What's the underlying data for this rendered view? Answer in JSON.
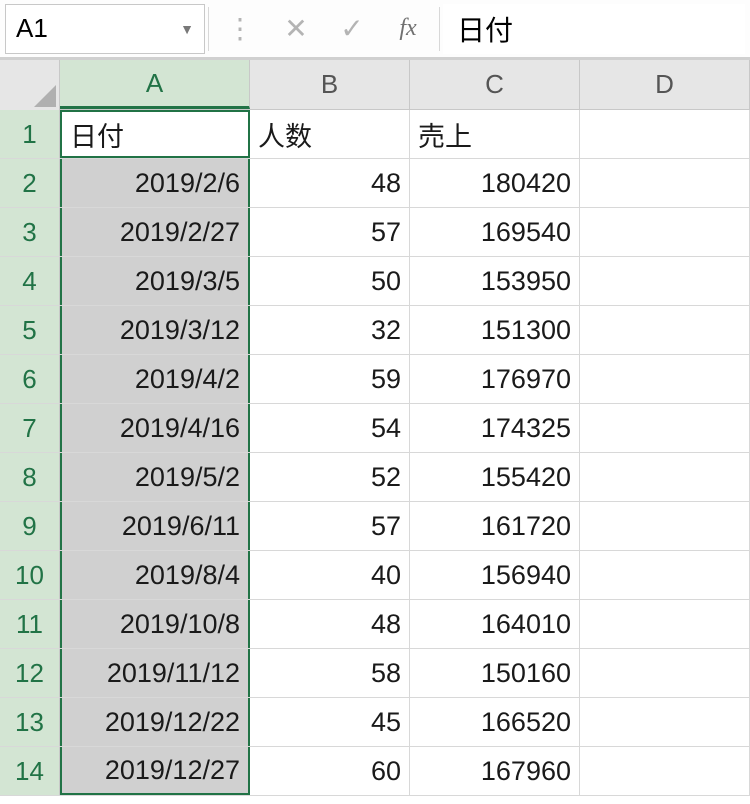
{
  "nameBox": {
    "value": "A1"
  },
  "formula": {
    "value": "日付"
  },
  "columns": [
    "A",
    "B",
    "C",
    "D"
  ],
  "headers": {
    "A": "日付",
    "B": "人数",
    "C": "売上"
  },
  "rows": [
    {
      "n": "1",
      "A": "日付",
      "B": "人数",
      "C": "売上"
    },
    {
      "n": "2",
      "A": "2019/2/6",
      "B": "48",
      "C": "180420"
    },
    {
      "n": "3",
      "A": "2019/2/27",
      "B": "57",
      "C": "169540"
    },
    {
      "n": "4",
      "A": "2019/3/5",
      "B": "50",
      "C": "153950"
    },
    {
      "n": "5",
      "A": "2019/3/12",
      "B": "32",
      "C": "151300"
    },
    {
      "n": "6",
      "A": "2019/4/2",
      "B": "59",
      "C": "176970"
    },
    {
      "n": "7",
      "A": "2019/4/16",
      "B": "54",
      "C": "174325"
    },
    {
      "n": "8",
      "A": "2019/5/2",
      "B": "52",
      "C": "155420"
    },
    {
      "n": "9",
      "A": "2019/6/11",
      "B": "57",
      "C": "161720"
    },
    {
      "n": "10",
      "A": "2019/8/4",
      "B": "40",
      "C": "156940"
    },
    {
      "n": "11",
      "A": "2019/10/8",
      "B": "48",
      "C": "164010"
    },
    {
      "n": "12",
      "A": "2019/11/12",
      "B": "58",
      "C": "150160"
    },
    {
      "n": "13",
      "A": "2019/12/22",
      "B": "45",
      "C": "166520"
    },
    {
      "n": "14",
      "A": "2019/12/27",
      "B": "60",
      "C": "167960"
    }
  ]
}
